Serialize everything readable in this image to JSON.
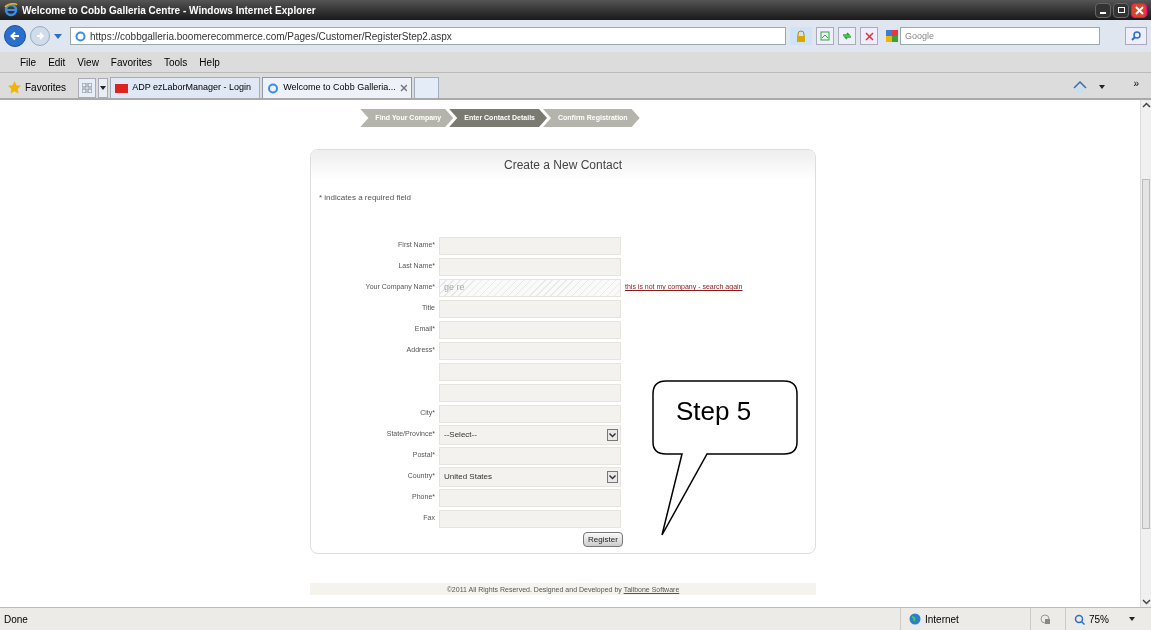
{
  "window": {
    "title": "Welcome to Cobb Galleria Centre - Windows Internet Explorer"
  },
  "address_bar": {
    "url": "https://cobbgalleria.boomerecommerce.com/Pages/Customer/RegisterStep2.aspx"
  },
  "search": {
    "placeholder": "Google"
  },
  "menu": [
    "File",
    "Edit",
    "View",
    "Favorites",
    "Tools",
    "Help"
  ],
  "favorites": {
    "label": "Favorites",
    "overflow": "»"
  },
  "tabs": [
    {
      "label": "ADP ezLaborManager - Login",
      "selected": false
    },
    {
      "label": "Welcome to Cobb Galleria...",
      "selected": true
    }
  ],
  "steps": [
    {
      "label": "Find Your Company",
      "selected": false
    },
    {
      "label": "Enter Contact Details",
      "selected": true
    },
    {
      "label": "Confirm Registration",
      "selected": false
    }
  ],
  "form": {
    "title": "Create a New Contact",
    "note": "* indicates a required field",
    "fields": [
      {
        "kind": "text",
        "label": "First Name*"
      },
      {
        "kind": "text",
        "label": "Last Name*"
      },
      {
        "kind": "locked",
        "label": "Your Company Name*",
        "value": "ge re",
        "link": "this is not my company - search again"
      },
      {
        "kind": "text",
        "label": "Title"
      },
      {
        "kind": "text",
        "label": "Email*"
      },
      {
        "kind": "text",
        "label": "Address*"
      },
      {
        "kind": "text"
      },
      {
        "kind": "text"
      },
      {
        "kind": "text",
        "label": "City*"
      },
      {
        "kind": "select",
        "label": "State/Province*",
        "value": "--Select--"
      },
      {
        "kind": "text",
        "label": "Postal*"
      },
      {
        "kind": "select",
        "label": "Country*",
        "value": "United States"
      },
      {
        "kind": "text",
        "label": "Phone*"
      },
      {
        "kind": "text",
        "label": "Fax"
      }
    ],
    "button": "Register"
  },
  "footer": {
    "text": "©2011 All Rights Reserved.  Designed and Developed by",
    "link": "Tallbone Software"
  },
  "callout": {
    "text": "Step 5"
  },
  "status_bar": {
    "text": "Done",
    "zone": "Internet",
    "zoom": "75%"
  }
}
